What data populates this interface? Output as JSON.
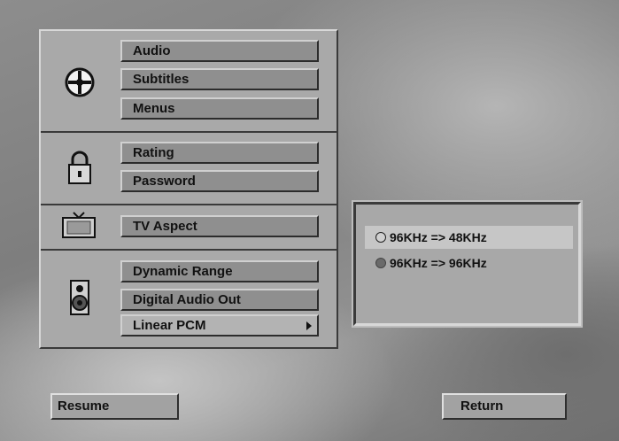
{
  "menu": {
    "sections": [
      {
        "icon": "disc-icon",
        "items": [
          "Audio",
          "Subtitles",
          "Menus"
        ]
      },
      {
        "icon": "lock-icon",
        "items": [
          "Rating",
          "Password"
        ]
      },
      {
        "icon": "tv-icon",
        "items": [
          "TV Aspect"
        ]
      },
      {
        "icon": "speaker-icon",
        "items": [
          "Dynamic Range",
          "Digital Audio Out",
          "Linear PCM"
        ]
      }
    ]
  },
  "options": {
    "items": [
      {
        "label": "96KHz => 48KHz",
        "selected": false,
        "highlighted": true
      },
      {
        "label": "96KHz => 96KHz",
        "selected": true,
        "highlighted": false
      }
    ]
  },
  "footer": {
    "resume_label": "Resume",
    "return_label": "Return"
  }
}
